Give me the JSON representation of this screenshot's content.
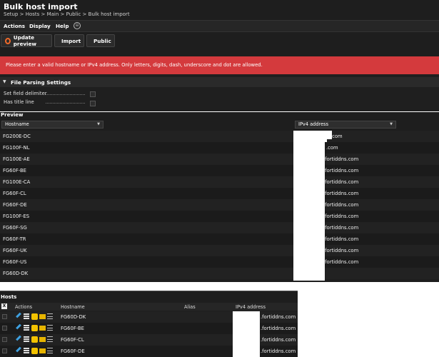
{
  "header": {
    "title": "Bulk host import",
    "breadcrumb": "Setup > Hosts > Main > Public > Bulk host import"
  },
  "menu": {
    "items": [
      "Actions",
      "Display",
      "Help"
    ]
  },
  "toolbar": {
    "update_preview": "Update preview",
    "import": "Import",
    "public": "Public"
  },
  "error": {
    "message": "Please enter a valid hostname or IPv4 address. Only letters, digits, dash, underscore and dot are allowed."
  },
  "parsing": {
    "title": "File Parsing Settings",
    "options": [
      {
        "label": "Set field delimiter",
        "checked": false
      },
      {
        "label": "Has title line",
        "checked": false
      }
    ]
  },
  "preview": {
    "label": "Preview",
    "columns": [
      "Hostname",
      "IPv4 address"
    ],
    "rows": [
      {
        "hostname": "FG200E-DC",
        "ip": ".com"
      },
      {
        "hostname": "FG100F-NL",
        "ip": ".com"
      },
      {
        "hostname": "FG100E-AE",
        "ip": ".fortiddns.com"
      },
      {
        "hostname": "FG60F-BE",
        "ip": ".fortiddns.com"
      },
      {
        "hostname": "FG100E-CA",
        "ip": ".fortiddns.com"
      },
      {
        "hostname": "FG60F-CL",
        "ip": ".fortiddns.com"
      },
      {
        "hostname": "FG60F-DE",
        "ip": ".fortiddns.com"
      },
      {
        "hostname": "FG100F-ES",
        "ip": ".fortiddns.com"
      },
      {
        "hostname": "FG60F-SG",
        "ip": ".fortiddns.com"
      },
      {
        "hostname": "FG60F-TR",
        "ip": ".fortiddns.com"
      },
      {
        "hostname": "FG60F-UK",
        "ip": ".fortiddns.com"
      },
      {
        "hostname": "FG60F-US",
        "ip": ".fortiddns.com"
      },
      {
        "hostname": "FG60D-DK",
        "ip": ""
      }
    ]
  },
  "hosts": {
    "title": "Hosts",
    "columns": {
      "select": "X",
      "actions": "Actions",
      "hostname": "Hostname",
      "alias": "Alias",
      "ip": "IPv4 address"
    },
    "rows": [
      {
        "hostname": "FG60D-DK",
        "ip": ".fortiddns.com"
      },
      {
        "hostname": "FG60F-BE",
        "ip": ".fortiddns.com"
      },
      {
        "hostname": "FG60F-CL",
        "ip": ".fortiddns.com"
      },
      {
        "hostname": "FG60F-DE",
        "ip": ".fortiddns.com"
      }
    ]
  },
  "colors": {
    "background": "#1e1e1e",
    "error": "#d43a3d",
    "update_icon": "#f06a2a",
    "import_icon": "#3bb54a",
    "public_icon": "#2f6fd6"
  },
  "icons": [
    "refresh-icon",
    "check-icon",
    "info-icon",
    "collapse-icon",
    "edit-icon",
    "list-icon",
    "hexagon-icon",
    "folder-icon",
    "menu-icon"
  ]
}
